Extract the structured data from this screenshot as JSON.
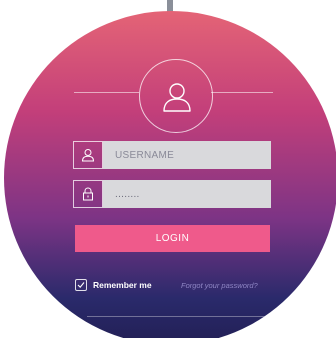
{
  "form": {
    "username_placeholder": "USERNAME",
    "password_value": "........",
    "login_label": "LOGIN",
    "remember_label": "Remember me",
    "remember_checked": true,
    "forgot_label": "Forgot your password?"
  },
  "icons": {
    "avatar": "user-icon",
    "username": "user-icon",
    "password": "lock-icon",
    "checkbox": "check-icon"
  },
  "colors": {
    "gradient_top": "#e46476",
    "gradient_mid": "#c33f7a",
    "gradient_low": "#7d3485",
    "gradient_bottom": "#221f55",
    "button": "#ef5a8b",
    "input_bg": "#d9d9dc",
    "forgot_text": "#8f86c4"
  }
}
